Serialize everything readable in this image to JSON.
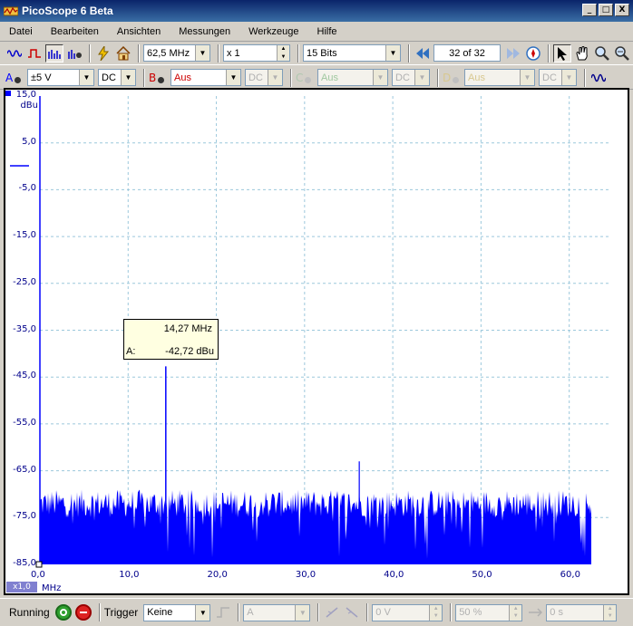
{
  "window": {
    "title": "PicoScope 6 Beta",
    "minimize": "_",
    "maximize": "□",
    "close": "X"
  },
  "menu": [
    "Datei",
    "Bearbeiten",
    "Ansichten",
    "Messungen",
    "Werkzeuge",
    "Hilfe"
  ],
  "toolbar1": {
    "timebase": "62,5 MHz",
    "zoom": "x 1",
    "resolution": "15 Bits",
    "buffer": "32 of 32"
  },
  "toolbar2": {
    "channels": [
      {
        "letter": "A",
        "range": "±5 V",
        "coupling": "DC",
        "color": "#0000ff",
        "enabled": true
      },
      {
        "letter": "B",
        "range": "Aus",
        "coupling": "DC",
        "color": "#cc0000",
        "enabled": false
      },
      {
        "letter": "C",
        "range": "Aus",
        "coupling": "DC",
        "color": "#008000",
        "enabled": false
      },
      {
        "letter": "D",
        "range": "Aus",
        "coupling": "DC",
        "color": "#c8a000",
        "enabled": false
      }
    ]
  },
  "plot": {
    "y_unit": "dBu",
    "x_unit": "MHz",
    "y_ticks": [
      "15,0",
      "5,0",
      "-5,0",
      "-15,0",
      "-25,0",
      "-35,0",
      "-45,0",
      "-55,0",
      "-65,0",
      "-75,0",
      "-85,0"
    ],
    "x_ticks": [
      "0,0",
      "10,0",
      "20,0",
      "30,0",
      "40,0",
      "50,0",
      "60,0"
    ],
    "zoom_badge": "x1,0",
    "trace_color": "#0000ff",
    "y_range": [
      -85,
      15
    ],
    "x_range": [
      0,
      62.5
    ],
    "noise_floor": [
      -85,
      -70
    ],
    "peak": {
      "freq": 14.27,
      "level": -42.72
    },
    "spur": {
      "freq": 36.2,
      "level": -63
    }
  },
  "tooltip": {
    "freq": "14,27 MHz",
    "channel": "A:",
    "value": "-42,72 dBu"
  },
  "statusbar": {
    "state": "Running",
    "trigger_label": "Trigger",
    "trigger_mode": "Keine",
    "trigger_channel": "A",
    "threshold": "0 V",
    "pretrigger": "50 %",
    "delay": "0 s"
  }
}
